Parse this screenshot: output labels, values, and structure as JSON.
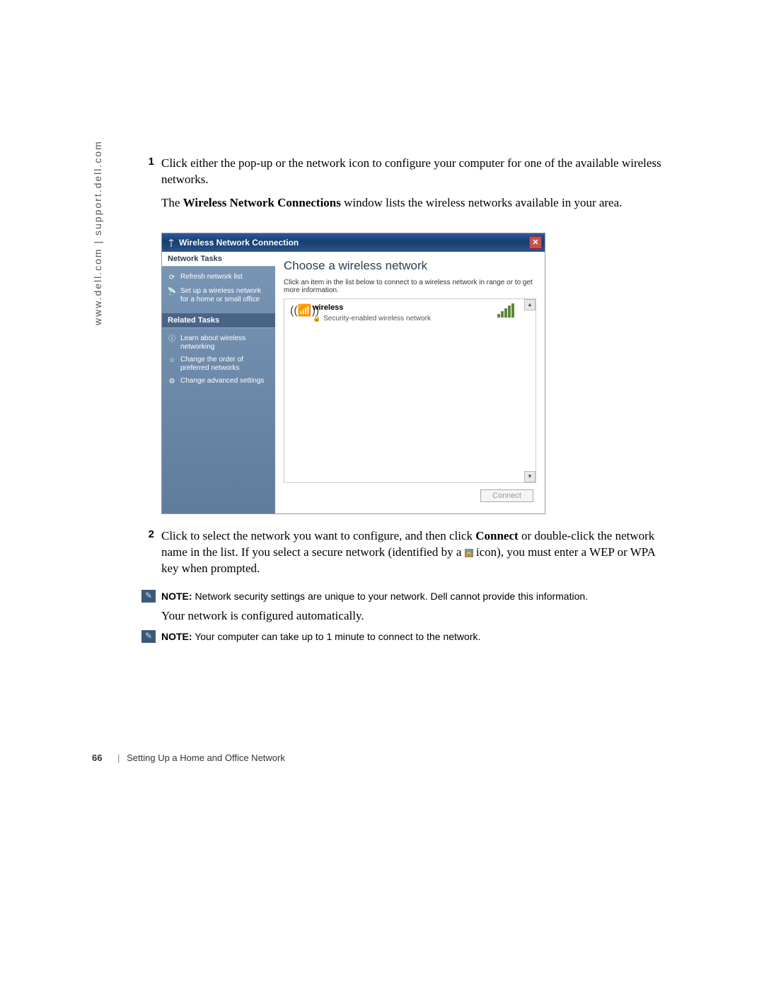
{
  "sidebar_url": "www.dell.com | support.dell.com",
  "step1": {
    "num": "1",
    "text_a": "Click either the pop-up or the network icon to configure your computer for one of the available wireless networks.",
    "text_b_pre": "The ",
    "text_b_bold": "Wireless Network Connections",
    "text_b_post": " window lists the wireless networks available in your area."
  },
  "window": {
    "title": "Wireless Network Connection",
    "left": {
      "tasks_hdr": "Network Tasks",
      "refresh": "Refresh network list",
      "setup": "Set up a wireless network for a home or small office",
      "related_hdr": "Related Tasks",
      "learn": "Learn about wireless networking",
      "order": "Change the order of preferred networks",
      "advanced": "Change advanced settings"
    },
    "right": {
      "title": "Choose a wireless network",
      "desc": "Click an item in the list below to connect to a wireless network in range or to get more information.",
      "net_name": "wireless",
      "net_sub": "Security-enabled wireless network",
      "connect_btn": "Connect"
    }
  },
  "step2": {
    "num": "2",
    "text_pre": "Click to select the network you want to configure, and then click ",
    "text_bold": "Connect",
    "text_mid": " or double-click the network name in the list. If you select a secure network (identified by a ",
    "text_post": " icon), you must enter a WEP or WPA key when prompted."
  },
  "note1": {
    "label": "NOTE:",
    "text": " Network security settings are unique to your network. Dell cannot provide this information."
  },
  "auto_text": "Your network is configured automatically.",
  "note2": {
    "label": "NOTE:",
    "text": " Your computer can take up to 1 minute to connect to the network."
  },
  "footer": {
    "page": "66",
    "section": "Setting Up a Home and Office Network"
  }
}
